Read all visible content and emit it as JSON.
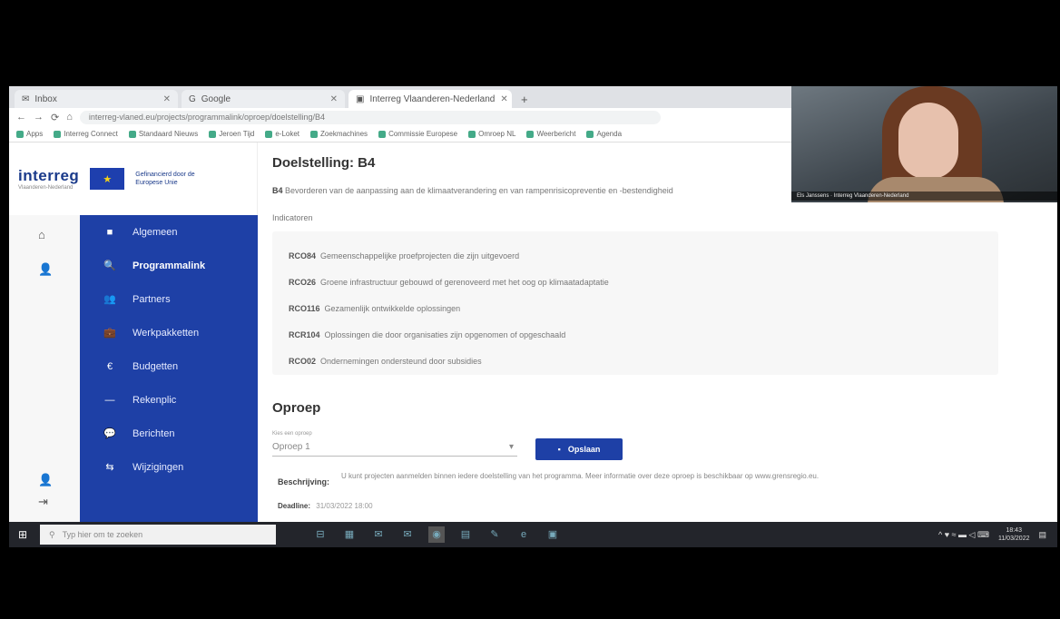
{
  "browser": {
    "tabs": [
      {
        "label": "Inbox",
        "active": false
      },
      {
        "label": "Google",
        "active": false
      },
      {
        "label": "Interreg Vlaanderen-Nederland",
        "active": true
      }
    ],
    "new_tab": "+",
    "nav": {
      "back": "←",
      "forward": "→",
      "reload": "⟳",
      "home": "⌂"
    },
    "url": "interreg-vlaned.eu/projects/programmalink/oproep/doelstelling/B4",
    "bookmarks": [
      "Apps",
      "Interreg Connect",
      "Standaard Nieuws",
      "Jeroen Tijd",
      "e-Loket",
      "Zoekmachines",
      "Commissie Europese",
      "Omroep NL",
      "Weerbericht",
      "Agenda"
    ]
  },
  "logo": {
    "word": "interreg",
    "subtitle": "Vlaanderen-Nederland",
    "eu_text": "Gefinancierd door de Europese Unie"
  },
  "nav": [
    {
      "icon": "■",
      "label": "Algemeen",
      "active": false
    },
    {
      "icon": "🔍",
      "label": "Programmalink",
      "active": true
    },
    {
      "icon": "👥",
      "label": "Partners",
      "active": false
    },
    {
      "icon": "💼",
      "label": "Werkpakketten",
      "active": false
    },
    {
      "icon": "€",
      "label": "Budgetten",
      "active": false
    },
    {
      "icon": "—",
      "label": "Rekenplic",
      "active": false
    },
    {
      "icon": "💬",
      "label": "Berichten",
      "active": false
    },
    {
      "icon": "⇆",
      "label": "Wijzigingen",
      "active": false
    }
  ],
  "main": {
    "goal_title": "Doelstelling: B4",
    "goal_code": "B4",
    "goal_desc": "Bevorderen van de aanpassing aan de klimaatverandering en van rampenrisicopreventie en -bestendigheid",
    "indicators_label": "Indicatoren",
    "indicators": [
      {
        "code": "RCO84",
        "text": "Gemeenschappelijke proefprojecten die zijn uitgevoerd"
      },
      {
        "code": "RCO26",
        "text": "Groene infrastructuur gebouwd of gerenoveerd met het oog op klimaatadaptatie"
      },
      {
        "code": "RCO116",
        "text": "Gezamenlijk ontwikkelde oplossingen"
      },
      {
        "code": "RCR104",
        "text": "Oplossingen die door organisaties zijn opgenomen of opgeschaald"
      },
      {
        "code": "RCO02",
        "text": "Ondernemingen ondersteund door subsidies"
      }
    ],
    "call_title": "Oproep",
    "call_select_label": "Kies een oproep",
    "call_select_value": "Oproep 1",
    "save_label": "Opslaan",
    "description_label": "Beschrijving:",
    "description_text": "U kunt projecten aanmelden binnen iedere doelstelling van het programma. Meer informatie over deze oproep is beschikbaar op www.grensregio.eu.",
    "deadline_label": "Deadline:",
    "deadline_value": "31/03/2022 18:00"
  },
  "taskbar": {
    "start": "⊞",
    "search_placeholder": "Typ hier om te zoeken",
    "apps": [
      "⊟",
      "▦",
      "✉",
      "✉",
      "◉",
      "▤",
      "✎",
      "e",
      "▣"
    ],
    "active_app_index": 4,
    "tray": "^ ♥ ≈ ▬ ◁ ⌨",
    "time": "18:43",
    "date": "11/03/2022"
  },
  "webcam": {
    "caption": "Els Janssens · Interreg Vlaanderen-Nederland"
  }
}
